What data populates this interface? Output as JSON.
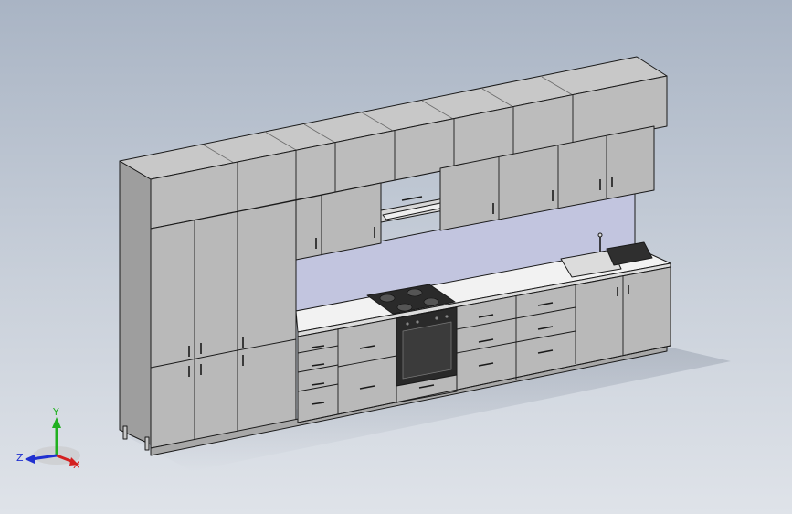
{
  "viewport": {
    "background_top": "#a9b4c4",
    "background_bottom": "#dfe3e9"
  },
  "model": {
    "subject": "kitchen-cabinet-assembly",
    "cabinet_color": "#b9b9b9",
    "cabinet_side_color": "#9e9e9e",
    "cabinet_top_color": "#c8c8c8",
    "backsplash_color": "#c2c5df",
    "countertop_color": "#f2f2f2",
    "cooktop_color": "#2a2a2a",
    "oven_glass_color": "#3b3b3b",
    "sink_color": "#dcdcdc",
    "edge_color": "#1a1a1a"
  },
  "triad": {
    "x_label": "X",
    "y_label": "Y",
    "z_label": "Z",
    "x_color": "#d42020",
    "y_color": "#20b020",
    "z_color": "#2030d0"
  }
}
